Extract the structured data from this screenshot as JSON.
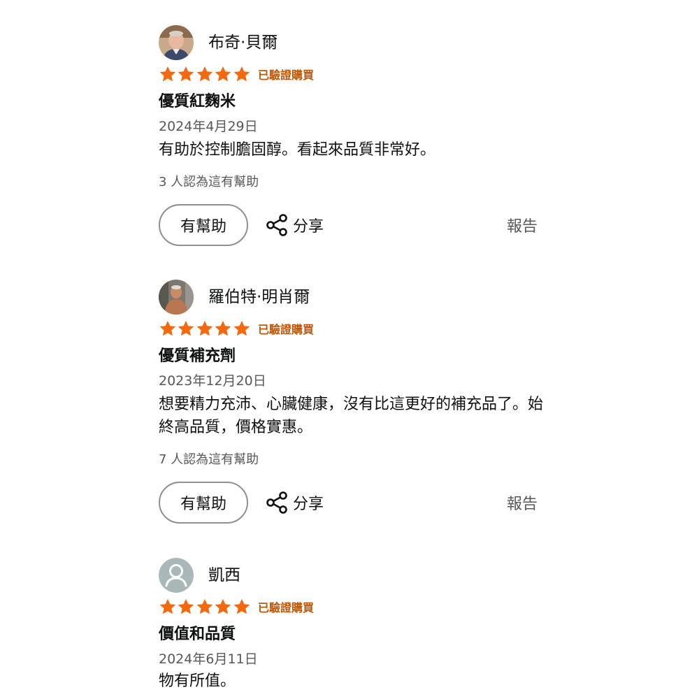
{
  "reviews": [
    {
      "reviewer": "布奇·貝爾",
      "avatar": "photo-avatar-icon",
      "rating": 5,
      "verified_label": "已驗證購買",
      "title": "優質紅麴米",
      "date": "2024年4月29日",
      "body": "有助於控制膽固醇。看起來品質非常好。",
      "helpful_count": "3 人認為這有幫助",
      "helpful_button": "有幫助",
      "share_label": "分享",
      "report_label": "報告"
    },
    {
      "reviewer": "羅伯特·明肖爾",
      "avatar": "photo-avatar-icon",
      "rating": 5,
      "verified_label": "已驗證購買",
      "title": "優質補充劑",
      "date": "2023年12月20日",
      "body": "想要精力充沛、心臟健康，沒有比這更好的補充品了。始終高品質，價格實惠。",
      "helpful_count": "7 人認為這有幫助",
      "helpful_button": "有幫助",
      "share_label": "分享",
      "report_label": "報告"
    },
    {
      "reviewer": "凱西",
      "avatar": "default-user-icon",
      "rating": 5,
      "verified_label": "已驗證購買",
      "title": "價值和品質",
      "date": "2024年6月11日",
      "body": "物有所值。"
    }
  ],
  "colors": {
    "star": "#f3690f",
    "verified": "#c45500",
    "secondary_text": "#565959",
    "button_border": "#8d9096"
  }
}
